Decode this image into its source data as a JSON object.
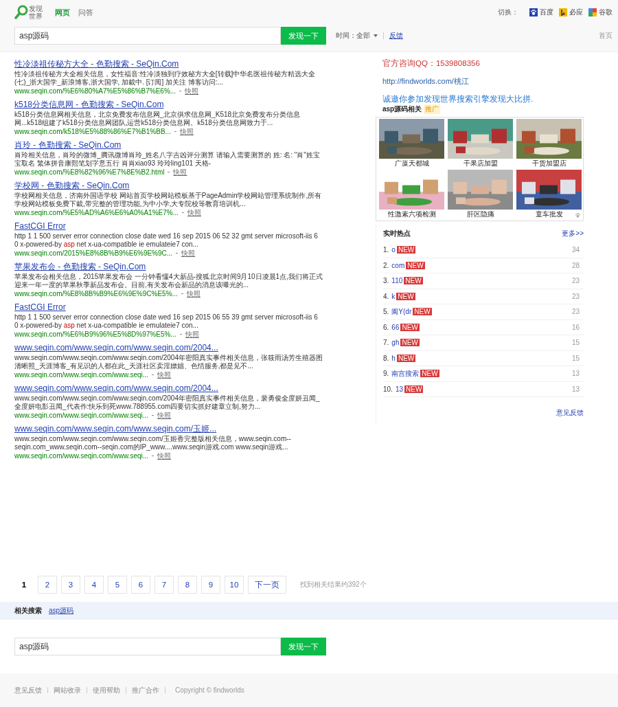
{
  "header": {
    "logo_lines": [
      "发现",
      "世界"
    ],
    "tabs": [
      {
        "label": "网页",
        "selected": true
      },
      {
        "label": "问答",
        "selected": false
      }
    ],
    "switch_label": "切换：",
    "engines": [
      {
        "kind": "paw",
        "label": "百度"
      },
      {
        "kind": "b",
        "label": "必应"
      },
      {
        "kind": "g",
        "label": "谷歌"
      }
    ],
    "search": {
      "value": "asp源码",
      "button": "发现一下"
    },
    "time_filter": "时间：全部",
    "feedback": "反馈",
    "home": "首页"
  },
  "results": [
    {
      "title": "性冷淡祖传秘方大全 - 色勤搜索 - SeQin.Com",
      "snippet": [
        {
          "text": "性冷淡祖传秘方大全相关信息，女性福音:性冷淡独到疗效秘方大全[转载]中华名医祖传秘方精选大全(七)_浙大国学_新浪博客,浙大国学, 加載中. [订阅] 加关注 博客访问:...",
          "highlight": false
        }
      ],
      "url": "www.seqin.com/%E6%80%A7%E5%86%B7%E6%...",
      "cache": "快照"
    },
    {
      "title": "k518分类信息网 - 色勤搜索 - SeQin.Com",
      "snippet": [
        {
          "text": "k518分类信息网相关信息，北京免费发布信息网_北京供求信息网_K518北京免费发布分类信息网...k518组建了k518分类信息网团队,运营k518分类信息网。k518分类信息网致力于...",
          "highlight": false
        }
      ],
      "url": "www.seqin.com/k518%E5%88%86%E7%B1%BB...",
      "cache": "快照"
    },
    {
      "title": "肖玲 - 色勤搜索 - SeQin.Com",
      "snippet": [
        {
          "text": "肖玲相关信息，肖玲的微博_腾讯微博肖玲_姓名八字吉凶评分测算 请输入需要测算的 姓: 名: \"肖\"姓宝宝取名 繁体拼音康熙笔划字意五行 肖肖xiao93 玲玲ling101 天格-",
          "highlight": false
        }
      ],
      "url": "www.seqin.com/%E8%82%96%E7%8E%B2.html",
      "cache": "快照"
    },
    {
      "title": "学校网 - 色勤搜索 - SeQin.Com",
      "snippet": [
        {
          "text": "学校网相关信息，济南外国语学校 网站首页学校网站模板基于PageAdmin学校网站管理系统制作,所有学校网站模板免费下載,带完整的管理功能,为中小学,大专院校等教育培训机...",
          "highlight": false
        }
      ],
      "url": "www.seqin.com/%E5%AD%A6%E6%A0%A1%E7%...",
      "cache": "快照"
    },
    {
      "title": "FastCGI Error",
      "snippet": [
        {
          "text": "http 1 1 500 server error connection close date wed 16 sep 2015 06 52 32 gmt server microsoft-iis 6 0 x-powered-by ",
          "highlight": false
        },
        {
          "text": "asp",
          "highlight": true
        },
        {
          "text": " net x-ua-compatible ie emulateie7 con...",
          "highlight": false
        }
      ],
      "url": "www.seqin.com/2015%E8%8B%B9%E6%9E%9C...",
      "cache": "快照"
    },
    {
      "title": "苹果发布会 - 色勤搜索 - SeQin.Com",
      "snippet": [
        {
          "text": "苹果发布会相关信息，2015苹果发布会 一分钟看懂4大新品-搜狐北京时间9月10日凌晨1点,我们将正式迎来一年一度的苹果秋季新品发布会。目前,有关发布会新品的消息该曝光的...",
          "highlight": false
        }
      ],
      "url": "www.seqin.com/%E8%8B%B9%E6%9E%9C%E5%...",
      "cache": "快照"
    },
    {
      "title": "FastCGI Error",
      "snippet": [
        {
          "text": "http 1 1 500 server error connection close date wed 16 sep 2015 06 55 39 gmt server microsoft-iis 6 0 x-powered-by ",
          "highlight": false
        },
        {
          "text": "asp",
          "highlight": true
        },
        {
          "text": " net x-ua-compatible ie emulateie7 con...",
          "highlight": false
        }
      ],
      "url": "www.seqin.com/%E6%B9%96%E5%8D%97%E5%...",
      "cache": "快照"
    },
    {
      "title": "www.seqin.com/www.seqin.com/www.seqin.com/2004...",
      "snippet": [
        {
          "text": "www.seqin.com/www.seqin.com/www.seqin.com/2004年密阳真实事件相关信息，张筱雨汤芳生殖器图清晰照_天涯博客_有见识的人都在此_天涯社区卖淫嫖娼、色情服务,都是见不...",
          "highlight": false
        }
      ],
      "url": "www.seqin.com/www.seqin.com/www.seqi...",
      "cache": "快照"
    },
    {
      "title": "www.seqin.com/www.seqin.com/www.seqin.com/2004...",
      "snippet": [
        {
          "text": "www.seqin.com/www.seqin.com/www.seqin.com/2004年密阳真实事件相关信息，裴勇俊全度妍丑闻_全度妍电影丑闻_代表作:快乐到死www.788955.com四要切实抓好建章立制,努力...",
          "highlight": false
        }
      ],
      "url": "www.seqin.com/www.seqin.com/www.seqi...",
      "cache": "快照"
    },
    {
      "title": "www.seqin.com/www.seqin.com/www.seqin.com/玉姬...",
      "snippet": [
        {
          "text": "www.seqin.com/www.seqin.com/www.seqin.com/玉姬香完整版相关信息，www.seqin.com--seqin.com_www.seqin.com--seqin.com的IP_www....www.seqin游戏.com www.seqin游戏...",
          "highlight": false
        }
      ],
      "url": "www.seqin.com/www.seqin.com/www.seqi...",
      "cache": "快照"
    }
  ],
  "pagination": {
    "pages": [
      {
        "label": "1",
        "selected": true
      },
      {
        "label": "2",
        "selected": false
      },
      {
        "label": "3",
        "selected": false
      },
      {
        "label": "4",
        "selected": false
      },
      {
        "label": "5",
        "selected": false
      },
      {
        "label": "6",
        "selected": false
      },
      {
        "label": "7",
        "selected": false
      },
      {
        "label": "8",
        "selected": false
      },
      {
        "label": "9",
        "selected": false
      },
      {
        "label": "10",
        "selected": false
      }
    ],
    "next": "下一页",
    "count": "找到相关结果约392个"
  },
  "sidebar": {
    "qq": "官方咨询QQ：1539808356",
    "link": "http://findworlds.com/桃江",
    "invite": "诚邀你参加发现世界搜索引擎发现大比拼.",
    "ads_title": "asp源码相关",
    "ads_badge": "推广",
    "ads": [
      {
        "caption": "广厦天都城",
        "kind": "picture"
      },
      {
        "caption": "干果店加盟",
        "kind": "picture"
      },
      {
        "caption": "干货加盟店",
        "kind": "picture"
      },
      {
        "caption": "性激素六项检测",
        "kind": "picture"
      },
      {
        "caption": "肝区隐痛",
        "kind": "picture"
      },
      {
        "caption": "童车批发",
        "kind": "picture"
      }
    ],
    "hot": {
      "title": "实时热点",
      "more": "更多>>",
      "items": [
        {
          "rank": "1.",
          "term": "o",
          "badge": "NEW",
          "count": "34"
        },
        {
          "rank": "2.",
          "term": "com",
          "badge": "NEW",
          "count": "28"
        },
        {
          "rank": "3.",
          "term": "110",
          "badge": "NEW",
          "count": "23"
        },
        {
          "rank": "4.",
          "term": "k",
          "badge": "NEW",
          "count": "23"
        },
        {
          "rank": "5.",
          "term": "阆Y(dr",
          "badge": "NEW",
          "count": "23"
        },
        {
          "rank": "6.",
          "term": "66",
          "badge": "NEW",
          "count": "16"
        },
        {
          "rank": "7.",
          "term": "gh",
          "badge": "NEW",
          "count": "15"
        },
        {
          "rank": "8.",
          "term": "h",
          "badge": "NEW",
          "count": "15"
        },
        {
          "rank": "9.",
          "term": "南宫搜索",
          "badge": "NEW",
          "count": "13"
        },
        {
          "rank": "10.",
          "term": "13",
          "badge": "NEW",
          "count": "13"
        }
      ],
      "feedback": "意见反馈"
    }
  },
  "related": {
    "label": "相关搜索",
    "links": [
      "asp源码"
    ]
  },
  "bottom_search": {
    "value": "asp源码",
    "button": "发现一下"
  },
  "footer": {
    "links": [
      "意见反馈",
      "网站收录",
      "使用帮助",
      "推广合作"
    ],
    "copyright": "Copyright © findworlds"
  }
}
